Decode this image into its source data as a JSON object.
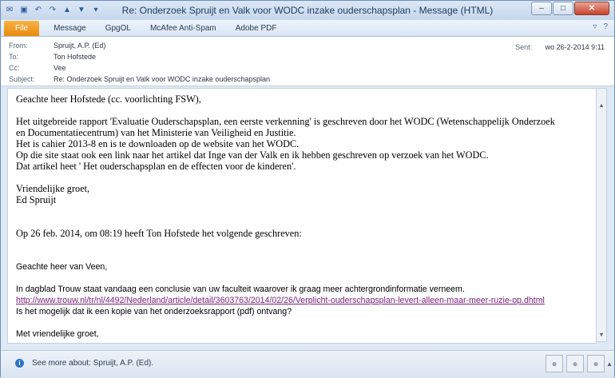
{
  "window": {
    "title": "Re: Onderzoek Spruijt en Valk voor WODC inzake ouderschapsplan  -  Message (HTML)",
    "quick_access": [
      "mail-icon",
      "save-icon",
      "undo-icon",
      "redo-icon",
      "up-icon",
      "down-icon",
      "customize-icon"
    ]
  },
  "ribbon": {
    "tabs": [
      "File",
      "Message",
      "GpgOL",
      "McAfee Anti-Spam",
      "Adobe PDF"
    ]
  },
  "header": {
    "from_label": "From:",
    "from_value": "Spruijt, A.P. (Ed)",
    "to_label": "To:",
    "to_value": "Ton Hofstede",
    "cc_label": "Cc:",
    "cc_value": "Vee",
    "subject_label": "Subject:",
    "subject_value": "Re: Onderzoek Spruijt en Valk voor WODC inzake ouderschapsplan",
    "sent_label": "Sent:",
    "sent_value": "wo 26-2-2014 9:11"
  },
  "body": {
    "greeting": "Geachte heer Hofstede (cc. voorlichting FSW),",
    "p1_l1": "Het uitgebreide rapport 'Evaluatie Ouderschapsplan, een eerste verkenning' is geschreven door het WODC (Wetenschappelijk Onderzoek",
    "p1_l2": "en Documentatiecentrum) van het Ministerie van Veiligheid en Justitie.",
    "p1_l3": "Het is cahier 2013-8 en is te downloaden op de website van het WODC.",
    "p1_l4": "Op die site staat ook een link naar het artikel dat Inge van der Valk en ik hebben geschreven op verzoek van het WODC.",
    "p1_l5": "Dat artikel heet ' Het ouderschapsplan en de effecten voor de kinderen'.",
    "closing": "Vriendelijke groet,",
    "signature": "Ed Spruijt",
    "quote_intro": "Op 26 feb. 2014, om 08:19 heeft Ton Hofstede het volgende geschreven:",
    "q_greeting": "Geachte heer van Veen,",
    "q_l1": "In dagblad Trouw staat vandaag een conclusie van uw faculteit waarover ik graag meer achtergrondinformatie verneem.",
    "q_link": "http://www.trouw.nl/tr/nl/4492/Nederland/article/detail/3603763/2014/02/26/Verplicht-ouderschapsplan-levert-alleen-maar-meer-ruzie-op.dhtml",
    "q_l2": "Is het mogelijk dat ik een kopie van het onderzoeksrapport (pdf) ontvang?",
    "q_closing": "Met vriendelijke groet,"
  },
  "footer": {
    "see_more": "See more about: Spruijt, A.P. (Ed)."
  }
}
